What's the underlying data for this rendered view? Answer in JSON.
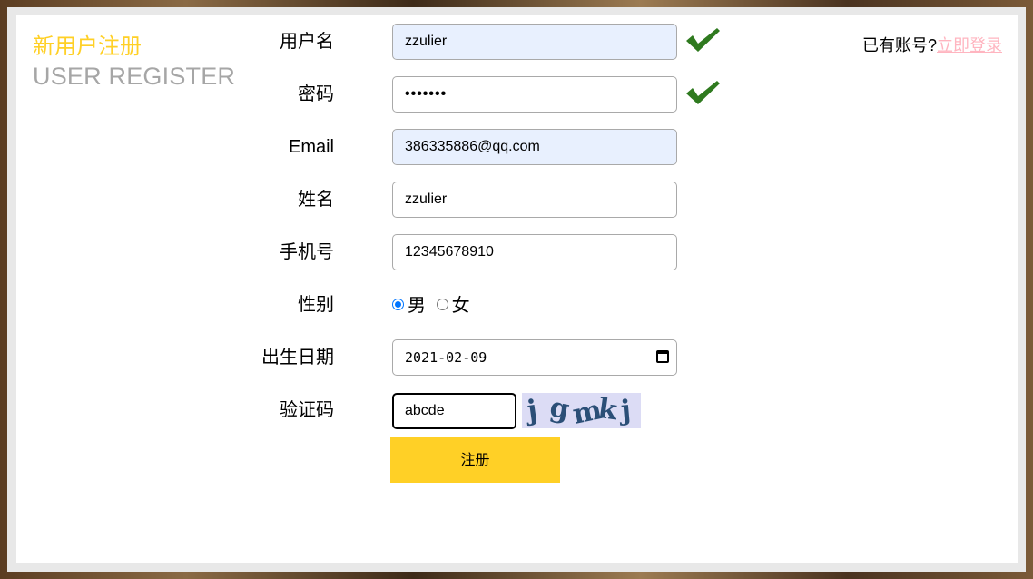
{
  "header": {
    "title_cn": "新用户注册",
    "title_en": "USER REGISTER",
    "login_prompt": "已有账号?",
    "login_link": "立即登录"
  },
  "form": {
    "username": {
      "label": "用户名",
      "value": "zzulier"
    },
    "password": {
      "label": "密码",
      "value": "•••••••"
    },
    "email": {
      "label": "Email",
      "value": "386335886@qq.com"
    },
    "name": {
      "label": "姓名",
      "value": "zzulier"
    },
    "phone": {
      "label": "手机号",
      "value": "12345678910"
    },
    "gender": {
      "label": "性别",
      "options": [
        "男",
        "女"
      ],
      "selected": "男"
    },
    "birthday": {
      "label": "出生日期",
      "value": "2021-02-09"
    },
    "captcha": {
      "label": "验证码",
      "value": "abcde",
      "image_text": "jgmkj"
    },
    "submit_label": "注册"
  },
  "icons": {
    "check": "check-icon",
    "calendar": "calendar-icon"
  },
  "colors": {
    "accent": "#ffd026",
    "title_en": "#a6a6a6",
    "link": "#ffb5c0",
    "check": "#2f7a1f"
  }
}
